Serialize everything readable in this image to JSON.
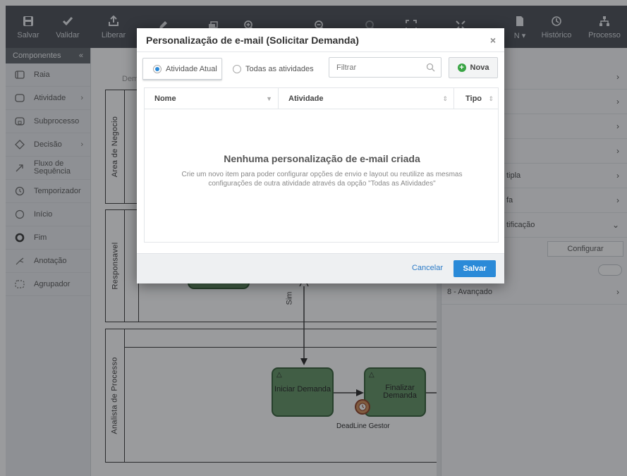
{
  "toolbar": {
    "buttons": [
      {
        "label": "Salvar",
        "icon": "save-icon"
      },
      {
        "label": "Validar",
        "icon": "check-icon"
      },
      {
        "label": "Liberar",
        "icon": "publish-icon"
      },
      {
        "label": "",
        "icon": "pencil-icon"
      },
      {
        "label": "",
        "icon": "layers-icon"
      },
      {
        "label": "",
        "icon": "zoom-in-icon"
      },
      {
        "label": "",
        "icon": "zoom-out-icon"
      },
      {
        "label": "",
        "icon": "search-icon"
      },
      {
        "label": "",
        "icon": "fit-screen-icon"
      },
      {
        "label": "",
        "icon": "expand-icon"
      },
      {
        "label": "N ▾",
        "icon": "document-icon"
      },
      {
        "label": "Histórico",
        "icon": "history-icon"
      },
      {
        "label": "Processo",
        "icon": "hierarchy-icon"
      }
    ]
  },
  "sidebar": {
    "title": "Componentes",
    "collapse": "«",
    "items": [
      {
        "label": "Raia",
        "icon": "lane-icon",
        "arrow": ""
      },
      {
        "label": "Atividade",
        "icon": "activity-icon",
        "arrow": "›"
      },
      {
        "label": "Subprocesso",
        "icon": "subprocess-icon",
        "arrow": ""
      },
      {
        "label": "Decisão",
        "icon": "diamond-icon",
        "arrow": "›"
      },
      {
        "label": "Fluxo de Sequência",
        "icon": "arrow-icon",
        "arrow": ""
      },
      {
        "label": "Temporizador",
        "icon": "clock-icon",
        "arrow": ""
      },
      {
        "label": "Início",
        "icon": "start-circle-icon",
        "arrow": ""
      },
      {
        "label": "Fim",
        "icon": "end-circle-icon",
        "arrow": ""
      },
      {
        "label": "Anotação",
        "icon": "annotation-icon",
        "arrow": ""
      },
      {
        "label": "Agrupador",
        "icon": "group-icon",
        "arrow": ""
      }
    ]
  },
  "canvas": {
    "header_label": "Dem",
    "lanes": [
      "Area de Negocio",
      "Responsavel",
      "Analista de Processo"
    ],
    "flow_label": "Sim",
    "tasks": [
      "Iniciar Demanda",
      "Finalizar Demanda"
    ],
    "timer_label": "DeadLine Gestor"
  },
  "right_panel": {
    "rows": [
      "",
      "",
      "",
      "",
      "tipla",
      "fa",
      "tificação"
    ],
    "configure_button": "Configurar",
    "advanced": "8 - Avançado"
  },
  "modal": {
    "title": "Personalização de e-mail (Solicitar Demanda)",
    "close": "×",
    "tab_current": "Atividade Atual",
    "tab_all": "Todas as atividades",
    "filter_placeholder": "Filtrar",
    "new_button": "Nova",
    "columns": {
      "name": "Nome",
      "activity": "Atividade",
      "type": "Tipo"
    },
    "empty_title": "Nenhuma personalização de e-mail criada",
    "empty_description": "Crie um novo item para poder configurar opções de envio e layout ou reutilize as mesmas configurações de outra atividade através da opção \"Todas as Atividades\"",
    "cancel": "Cancelar",
    "save": "Salvar"
  },
  "colors": {
    "toolbar": "#454a50",
    "primary": "#2a8ad8",
    "task_fill": "#5e9060",
    "new_plus": "#3aa545"
  }
}
